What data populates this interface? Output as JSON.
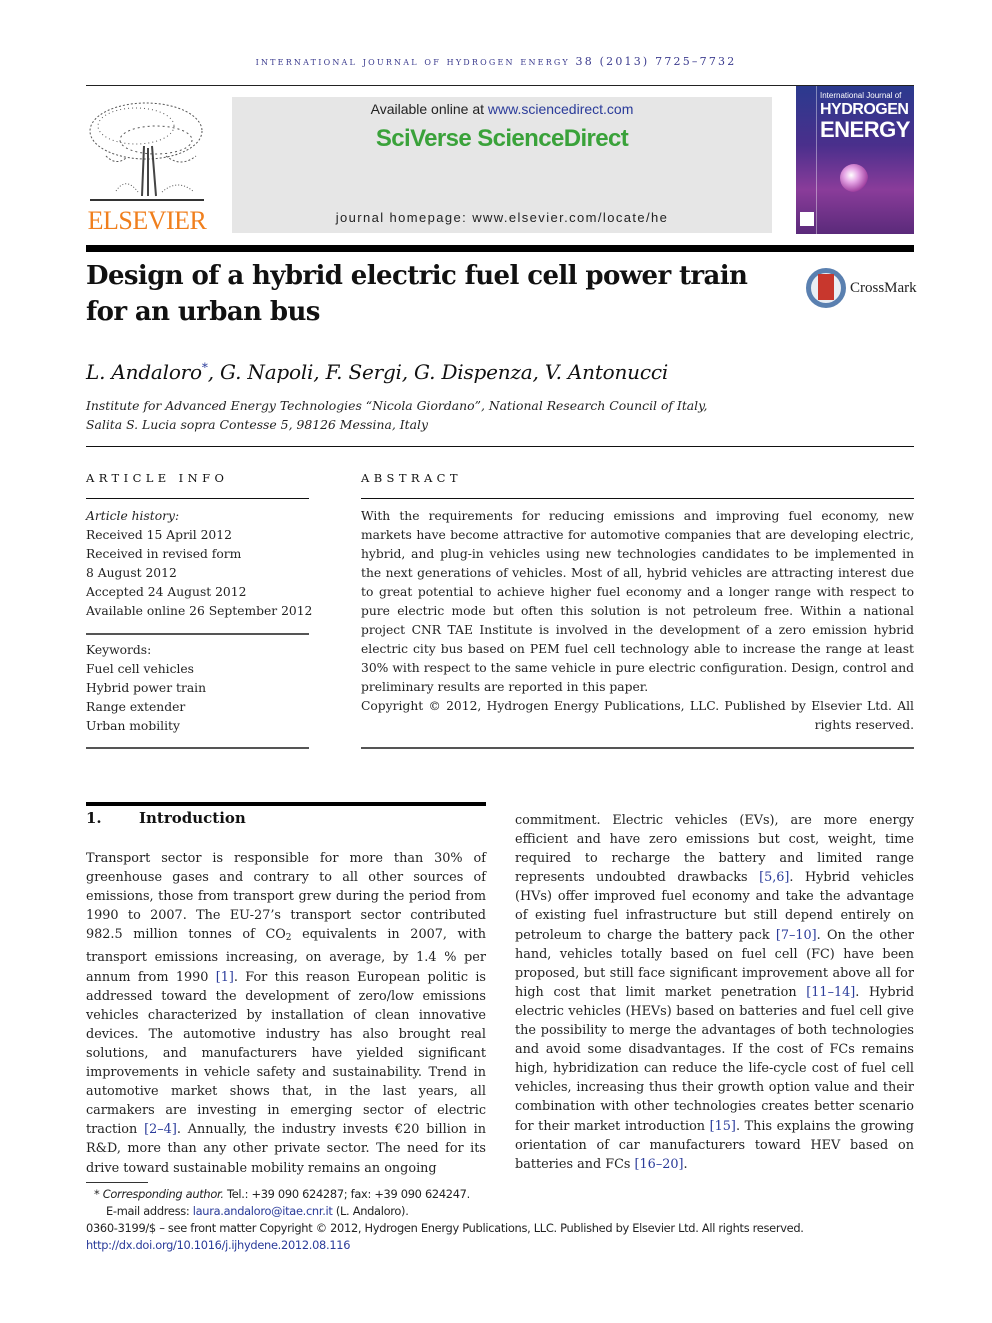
{
  "running_head": "INTERNATIONAL JOURNAL OF HYDROGEN ENERGY 38 (2013) 7725–7732",
  "publisher": {
    "logo_icon": "elsevier-tree-icon",
    "name": "ELSEVIER"
  },
  "banner": {
    "available_prefix": "Available online at ",
    "available_link": "www.sciencedirect.com",
    "brand": "SciVerse ScienceDirect",
    "homepage": "journal homepage: www.elsevier.com/locate/he"
  },
  "cover": {
    "line1": "International Journal of",
    "line2": "HYDROGEN",
    "line3": "ENERGY"
  },
  "crossmark": {
    "icon": "crossmark-icon",
    "label": "CrossMark"
  },
  "article": {
    "title": "Design of a hybrid electric fuel cell power train for an urban bus",
    "authors_first": "L. Andaloro",
    "authors_star": "*",
    "authors_rest": ", G. Napoli, F. Sergi, G. Dispenza, V. Antonucci",
    "affiliation_line1": "Institute for Advanced Energy Technologies “Nicola Giordano”, National Research Council of Italy,",
    "affiliation_line2": "Salita S. Lucia sopra Contesse 5, 98126 Messina, Italy"
  },
  "article_info": {
    "heading": "ARTICLE INFO",
    "history_label": "Article history:",
    "history": [
      "Received 15 April 2012",
      "Received in revised form",
      "8 August 2012",
      "Accepted 24 August 2012",
      "Available online 26 September 2012"
    ],
    "keywords_label": "Keywords:",
    "keywords": [
      "Fuel cell vehicles",
      "Hybrid power train",
      "Range extender",
      "Urban mobility"
    ]
  },
  "abstract": {
    "heading": "ABSTRACT",
    "text": "With the requirements for reducing emissions and improving fuel economy, new markets have become attractive for automotive companies that are developing electric, hybrid, and plug-in vehicles using new technologies candidates to be implemented in the next generations of vehicles. Most of all, hybrid vehicles are attracting interest due to great potential to achieve higher fuel economy and a longer range with respect to pure electric mode but often this solution is not petroleum free. Within a national project CNR TAE Institute is involved in the development of a zero emission hybrid electric city bus based on PEM fuel cell technology able to increase the range at least 30% with respect to the same vehicle in pure electric configuration. Design, control and preliminary results are reported in this paper.",
    "copyright": "Copyright © 2012, Hydrogen Energy Publications, LLC. Published by Elsevier Ltd. All rights reserved."
  },
  "introduction": {
    "number": "1.",
    "heading": "Introduction",
    "left": {
      "p1": "Transport sector is responsible for more than 30% of greenhouse gases and contrary to all other sources of emissions, those from transport grew during the period from 1990 to 2007. The EU-27’s transport sector contributed 982.5 million tonnes of CO",
      "sub": "2",
      "p2": " equivalents in 2007, with transport emissions increasing, on average, by 1.4 % per annum from 1990 ",
      "cite1": "[1]",
      "p3": ". For this reason European politic is addressed toward the development of zero/low emissions vehicles characterized by installation of clean innovative devices. The automotive industry has also brought real solutions, and manufacturers have yielded significant improvements in vehicle safety and sustainability. Trend in automotive market shows that, in the last years, all carmakers are investing in emerging sector of electric traction ",
      "cite2": "[2–4]",
      "p4": ". Annually, the industry invests €20 billion in R&D, more than any other private sector. The need for its drive toward sustainable mobility remains an ongoing"
    },
    "right": {
      "p1": "commitment. Electric vehicles (EVs), are more energy efficient and have zero emissions but cost, weight, time required to recharge the battery and limited range represents undoubted drawbacks ",
      "cite1": "[5,6]",
      "p2": ". Hybrid vehicles (HVs) offer improved fuel economy and take the advantage of existing fuel infrastructure but still depend entirely on petroleum to charge the battery pack ",
      "cite2": "[7–10]",
      "p3": ". On the other hand, vehicles totally based on fuel cell (FC) have been proposed, but still face significant improvement above all for high cost that limit market penetration ",
      "cite3": "[11–14]",
      "p4": ". Hybrid electric vehicles (HEVs) based on batteries and fuel cell give the possibility to merge the advantages of both technologies and avoid some disadvantages. If the cost of FCs remains high, hybridization can reduce the life-cycle cost of fuel cell vehicles, increasing thus their growth option value and their combination with other technologies creates better scenario for their market introduction ",
      "cite4": "[15]",
      "p5": ". This explains the growing orientation of car manufacturers toward HEV based on batteries and FCs ",
      "cite5": "[16–20]",
      "p6": "."
    }
  },
  "footnotes": {
    "star": "*",
    "corresponding_label": "Corresponding author.",
    "contact": " Tel.: +39 090 624287; fax: +39 090 624247.",
    "email_label": "E-mail address: ",
    "email": "laura.andaloro@itae.cnr.it",
    "email_suffix": " (L. Andaloro).",
    "issn_line": "0360-3199/$ – see front matter Copyright © 2012, Hydrogen Energy Publications, LLC. Published by Elsevier Ltd. All rights reserved.",
    "doi": "http://dx.doi.org/10.1016/j.ijhydene.2012.08.116"
  },
  "colors": {
    "link": "#2a3b9a",
    "elsevier_orange": "#f07f1d",
    "sciencedirect_green": "#3aa23a"
  }
}
